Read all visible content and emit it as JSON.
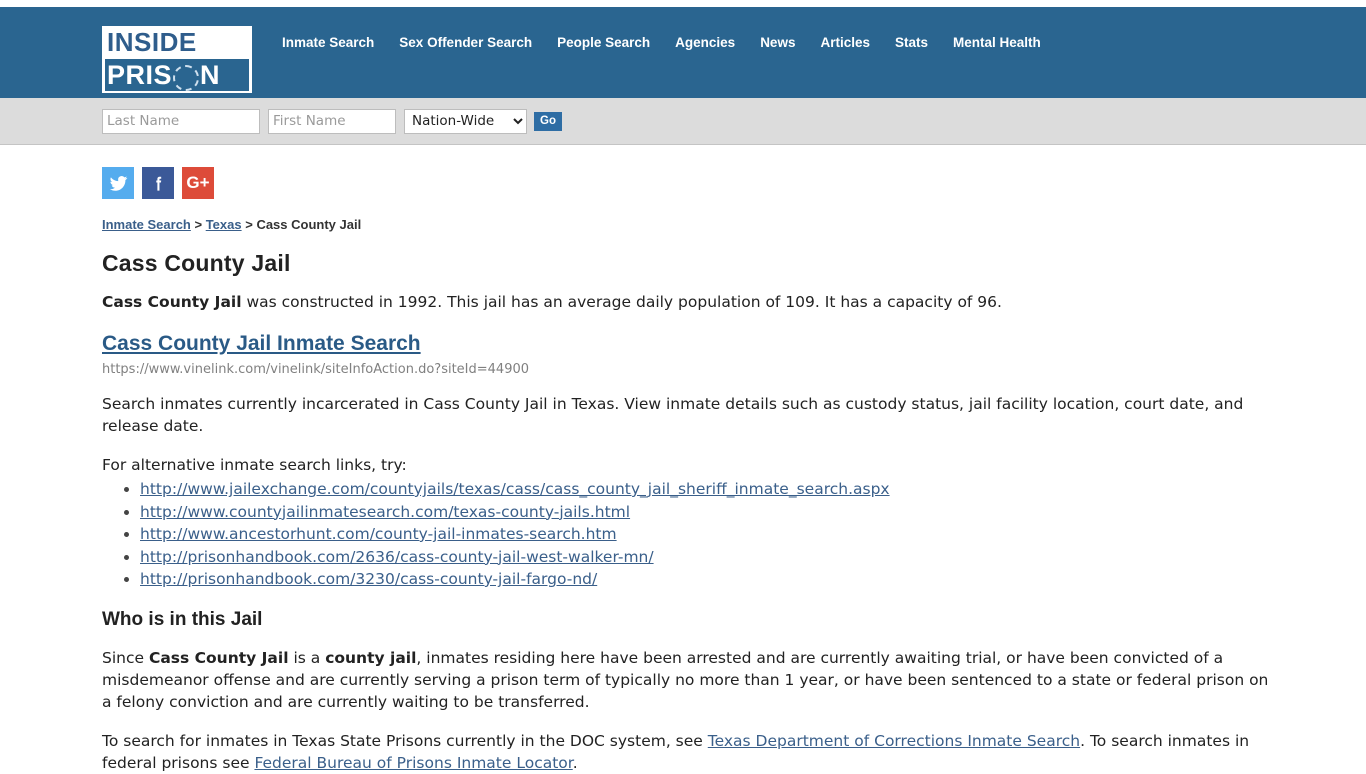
{
  "header": {
    "logo": {
      "line1": "INSIDE",
      "line2_part1": "PRIS",
      "line2_part2": "N"
    },
    "nav": [
      {
        "label": "Inmate Search"
      },
      {
        "label": "Sex Offender Search"
      },
      {
        "label": "People Search"
      },
      {
        "label": "Agencies"
      },
      {
        "label": "News"
      },
      {
        "label": "Articles"
      },
      {
        "label": "Stats"
      },
      {
        "label": "Mental Health"
      }
    ],
    "brand_color": "#2a6590"
  },
  "search": {
    "last_name_placeholder": "Last Name",
    "last_name_value": "",
    "first_name_placeholder": "First Name",
    "first_name_value": "",
    "scope_selected": "Nation-Wide",
    "scope_options": [
      "Nation-Wide"
    ],
    "go_label": "Go"
  },
  "social": {
    "twitter_glyph": "ᴠ",
    "facebook_glyph": "f",
    "google_glyph": "G+",
    "twitter_color": "#55acee",
    "facebook_color": "#3b5998",
    "google_color": "#dd4b39"
  },
  "breadcrumb": {
    "item1": "Inmate Search",
    "sep1": " > ",
    "item2": "Texas",
    "sep2": " > ",
    "current": "Cass County Jail"
  },
  "page": {
    "title": "Cass County Jail",
    "intro_bold": "Cass County Jail",
    "intro_rest": " was constructed in 1992. This jail has an average daily population of 109. It has a capacity of 96.",
    "constructed_year": "1992",
    "average_daily_population": "109",
    "capacity": "96",
    "search_link_label": "Cass County Jail Inmate Search",
    "search_link_url": "https://www.vinelink.com/vinelink/siteInfoAction.do?siteId=44900",
    "description": "Search inmates currently incarcerated in Cass County Jail in Texas. View inmate details such as custody status, jail facility location, court date, and release date.",
    "alt_intro": "For alternative inmate search links, try:",
    "alt_links": [
      "http://www.jailexchange.com/countyjails/texas/cass/cass_county_jail_sheriff_inmate_search.aspx",
      "http://www.countyjailinmatesearch.com/texas-county-jails.html",
      "http://www.ancestorhunt.com/county-jail-inmates-search.htm",
      "http://prisonhandbook.com/2636/cass-county-jail-west-walker-mn/",
      "http://prisonhandbook.com/3230/cass-county-jail-fargo-nd/"
    ],
    "who_title": "Who is in this Jail",
    "who_p1_a": "Since ",
    "who_p1_b": "Cass County Jail",
    "who_p1_c": " is a ",
    "who_p1_d": "county jail",
    "who_p1_e": ", inmates residing here have been arrested and are currently awaiting trial, or have been convicted of a misdemeanor offense and are currently serving a prison term of typically no more than 1 year, or have been sentenced to a state or federal prison on a felony conviction and are currently waiting to be transferred.",
    "doc_p_a": "To search for inmates in Texas State Prisons currently in the DOC system, see ",
    "doc_link1": "Texas Department of Corrections Inmate Search",
    "doc_p_b": ". To search inmates in federal prisons see ",
    "doc_link2": "Federal Bureau of Prisons Inmate Locator",
    "doc_p_c": "."
  }
}
